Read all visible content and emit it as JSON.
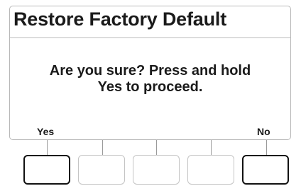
{
  "screen": {
    "title": "Restore Factory Default",
    "message_line1": "Are you sure? Press and hold",
    "message_line2": "Yes to proceed."
  },
  "softkeys": {
    "key1_label": "Yes",
    "key5_label": "No"
  }
}
